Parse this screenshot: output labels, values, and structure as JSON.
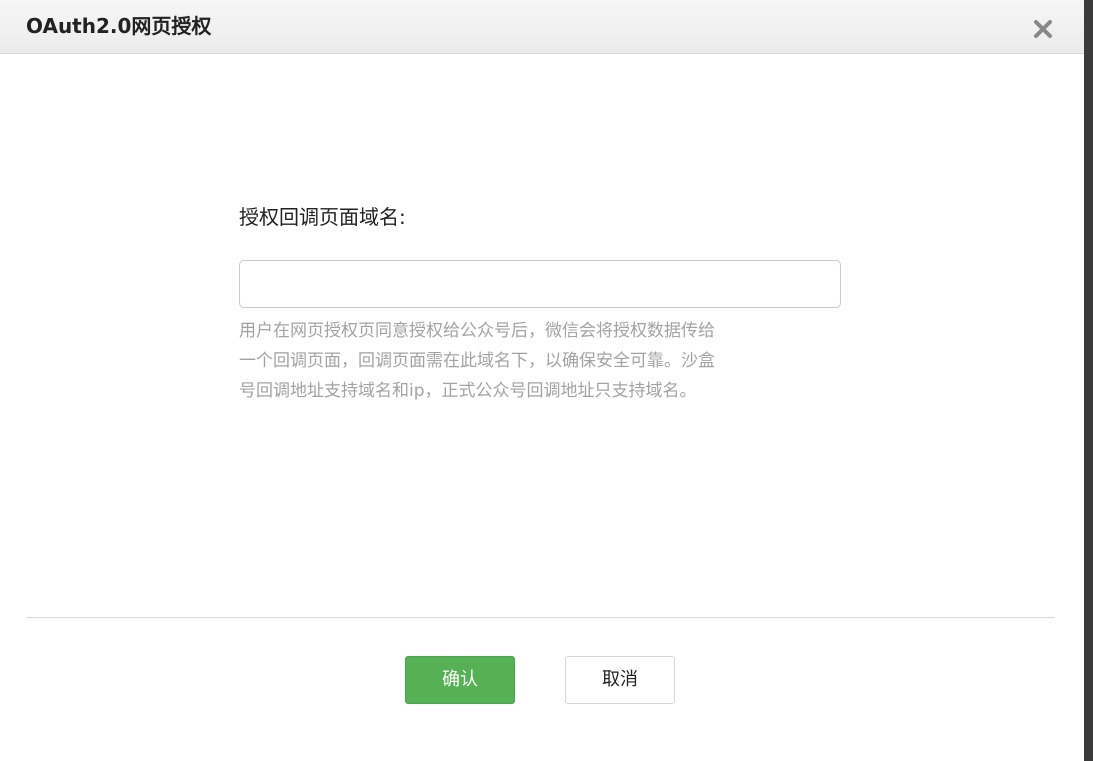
{
  "dialog": {
    "title": "OAuth2.0网页授权",
    "close_icon": "close-icon"
  },
  "form": {
    "label": "授权回调页面域名:",
    "input_value": "",
    "input_placeholder": "",
    "help_lines": [
      "用户在网页授权页同意授权给公众号后，微信会将授权数据传给",
      "一个回调页面，回调页面需在此域名下，以确保安全可靠。沙盒",
      "号回调地址支持域名和ip，正式公众号回调地址只支持域名。"
    ]
  },
  "footer": {
    "confirm_label": "确认",
    "cancel_label": "取消"
  },
  "colors": {
    "primary": "#56b054",
    "help_text": "#a3a3a3",
    "header_bg": "#f0f0f0"
  }
}
